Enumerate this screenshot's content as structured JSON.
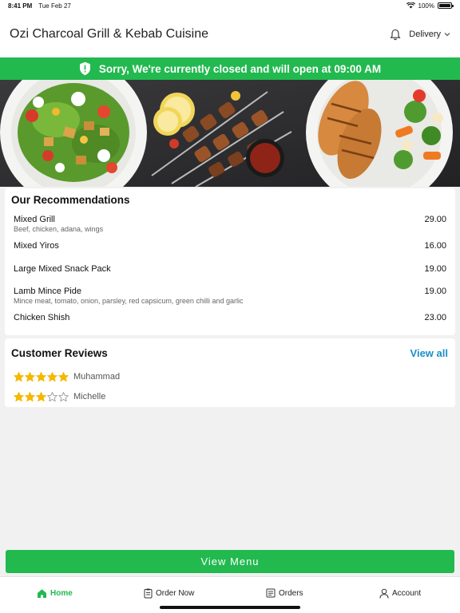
{
  "status_bar": {
    "time": "8:41 PM",
    "date": "Tue Feb 27",
    "battery": "100%",
    "battery_level": 1.0
  },
  "header": {
    "title": "Ozi Charcoal Grill & Kebab Cuisine",
    "delivery_label": "Delivery",
    "bell_icon": "bell-icon",
    "chevron_icon": "chevron-down-icon"
  },
  "banner": {
    "text": "Sorry, We're currently closed and will open at 09:00 AM",
    "icon": "shield-icon"
  },
  "recommendations": {
    "title": "Our Recommendations",
    "items": [
      {
        "name": "Mixed Grill",
        "desc": "Beef, chicken, adana, wings",
        "price": "29.00"
      },
      {
        "name": "Mixed Yiros",
        "desc": "",
        "price": "16.00"
      },
      {
        "name": "Large Mixed Snack Pack",
        "desc": "",
        "price": "19.00"
      },
      {
        "name": "Lamb Mince Pide",
        "desc": "Mince meat, tomato, onion, parsley, red capsicum, green chilli and garlic",
        "price": "19.00"
      },
      {
        "name": "Chicken Shish",
        "desc": "",
        "price": "23.00"
      }
    ]
  },
  "reviews": {
    "title": "Customer Reviews",
    "view_all": "View all",
    "items": [
      {
        "name": "Muhammad",
        "rating": 5
      },
      {
        "name": "Michelle",
        "rating": 3
      }
    ]
  },
  "view_menu_label": "View Menu",
  "tabs": [
    {
      "label": "Home",
      "icon": "home-icon",
      "active": true
    },
    {
      "label": "Order Now",
      "icon": "order-icon",
      "active": false
    },
    {
      "label": "Orders",
      "icon": "receipt-icon",
      "active": false
    },
    {
      "label": "Account",
      "icon": "user-icon",
      "active": false
    }
  ],
  "colors": {
    "accent": "#22b94f",
    "link": "#1a8fc7",
    "star": "#f5b800"
  }
}
